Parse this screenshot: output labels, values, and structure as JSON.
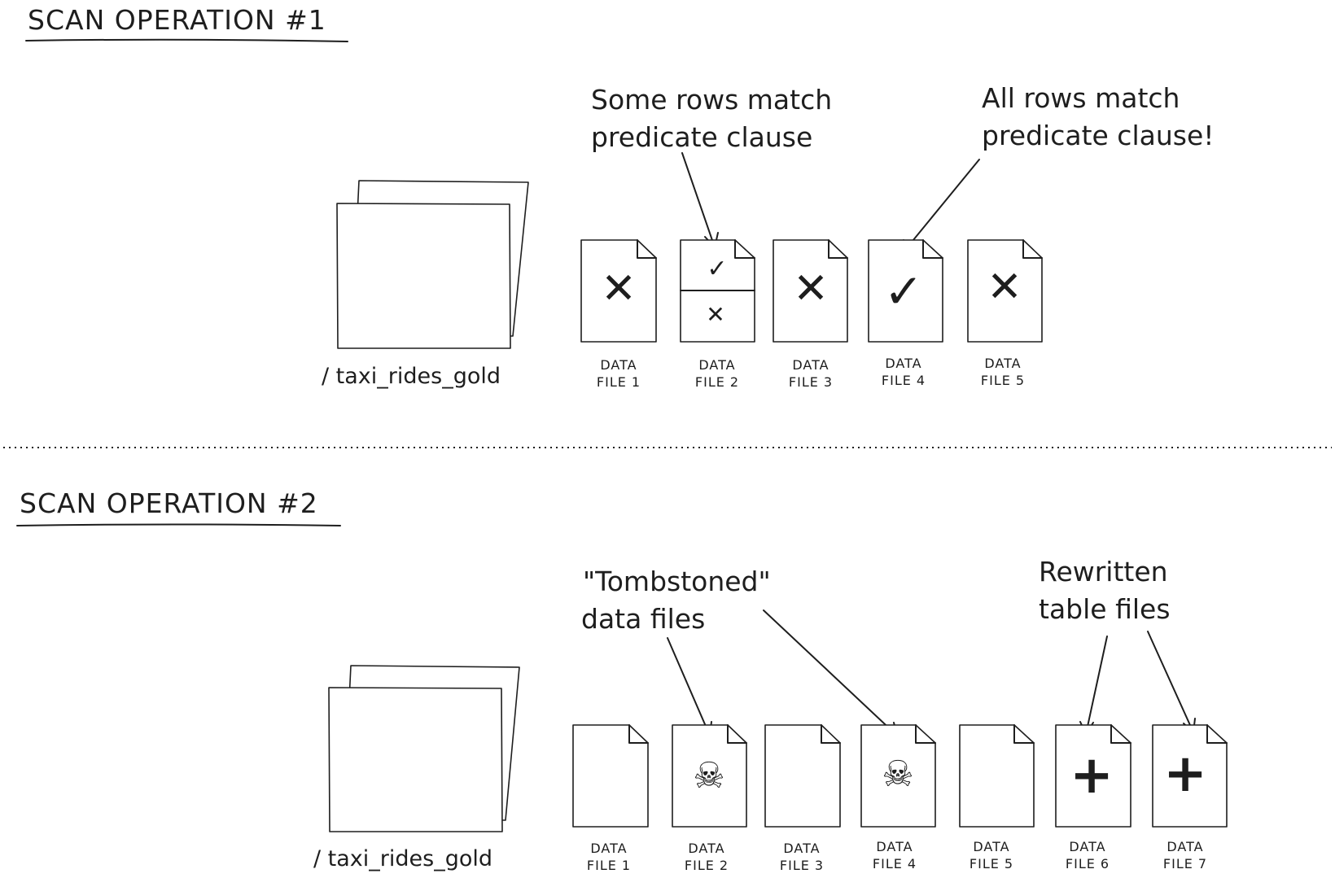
{
  "sections": [
    {
      "title": "SCAN OPERATION #1",
      "folder_label": "/ taxi_rides_gold",
      "files": [
        {
          "line1": "DATA",
          "line2": "FILE 1",
          "mark": "x-icon"
        },
        {
          "line1": "DATA",
          "line2": "FILE 2",
          "mark": "split-check-x-icon"
        },
        {
          "line1": "DATA",
          "line2": "FILE 3",
          "mark": "x-icon"
        },
        {
          "line1": "DATA",
          "line2": "FILE 4",
          "mark": "check-icon"
        },
        {
          "line1": "DATA",
          "line2": "FILE 5",
          "mark": "x-icon"
        }
      ],
      "callouts": [
        {
          "line1": "Some rows match",
          "line2": "predicate clause"
        },
        {
          "line1": "All rows match",
          "line2": "predicate clause!"
        }
      ]
    },
    {
      "title": "SCAN OPERATION #2",
      "folder_label": "/ taxi_rides_gold",
      "files": [
        {
          "line1": "DATA",
          "line2": "FILE 1",
          "mark": "none"
        },
        {
          "line1": "DATA",
          "line2": "FILE 2",
          "mark": "skull-icon"
        },
        {
          "line1": "DATA",
          "line2": "FILE 3",
          "mark": "none"
        },
        {
          "line1": "DATA",
          "line2": "FILE 4",
          "mark": "skull-icon"
        },
        {
          "line1": "DATA",
          "line2": "FILE 5",
          "mark": "none"
        },
        {
          "line1": "DATA",
          "line2": "FILE 6",
          "mark": "plus-icon"
        },
        {
          "line1": "DATA",
          "line2": "FILE 7",
          "mark": "plus-icon"
        }
      ],
      "callouts": [
        {
          "line1": "\"Tombstoned\"",
          "line2": "data files"
        },
        {
          "line1": "Rewritten",
          "line2": "table files"
        }
      ]
    }
  ],
  "glyphs": {
    "check": "✓",
    "cross": "✕",
    "plus": "+",
    "skull": "☠"
  }
}
